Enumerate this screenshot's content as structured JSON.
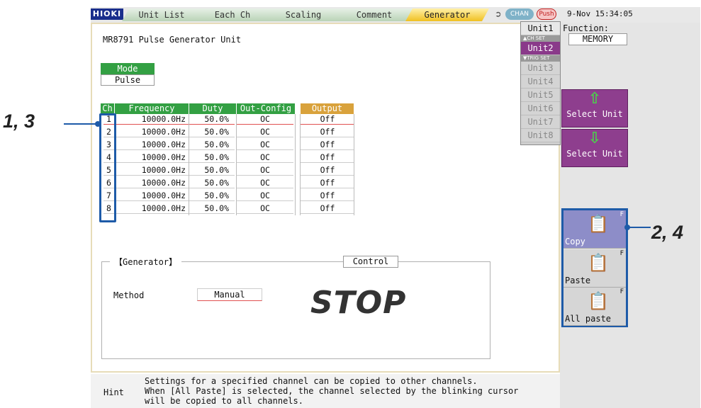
{
  "header": {
    "logo": "HIOKI",
    "tabs": [
      {
        "label": "Unit List",
        "active": false
      },
      {
        "label": "Each Ch",
        "active": false
      },
      {
        "label": "Scaling",
        "active": false
      },
      {
        "label": "Comment",
        "active": false
      },
      {
        "label": "Generator",
        "active": true
      }
    ],
    "chan_label": "CHAN",
    "push_label": "Push",
    "datetime": "9-Nov 15:34:05"
  },
  "main": {
    "unit_title": "MR8791 Pulse Generator Unit",
    "mode": {
      "header": "Mode",
      "value": "Pulse"
    },
    "table": {
      "headers": {
        "ch": "Ch",
        "frequency": "Frequency",
        "duty": "Duty",
        "out_config": "Out-Config",
        "output": "Output"
      },
      "rows": [
        {
          "ch": "1",
          "frequency": "10000.0Hz",
          "duty": "50.0%",
          "out_config": "OC",
          "output": "Off"
        },
        {
          "ch": "2",
          "frequency": "10000.0Hz",
          "duty": "50.0%",
          "out_config": "OC",
          "output": "Off"
        },
        {
          "ch": "3",
          "frequency": "10000.0Hz",
          "duty": "50.0%",
          "out_config": "OC",
          "output": "Off"
        },
        {
          "ch": "4",
          "frequency": "10000.0Hz",
          "duty": "50.0%",
          "out_config": "OC",
          "output": "Off"
        },
        {
          "ch": "5",
          "frequency": "10000.0Hz",
          "duty": "50.0%",
          "out_config": "OC",
          "output": "Off"
        },
        {
          "ch": "6",
          "frequency": "10000.0Hz",
          "duty": "50.0%",
          "out_config": "OC",
          "output": "Off"
        },
        {
          "ch": "7",
          "frequency": "10000.0Hz",
          "duty": "50.0%",
          "out_config": "OC",
          "output": "Off"
        },
        {
          "ch": "8",
          "frequency": "10000.0Hz",
          "duty": "50.0%",
          "out_config": "OC",
          "output": "Off"
        }
      ]
    },
    "generator": {
      "group_label": "【Generator】",
      "control_button": "Control",
      "method_label": "Method",
      "method_value": "Manual",
      "status": "STOP"
    }
  },
  "hint": {
    "label": "Hint",
    "line1": "Settings for a specified channel can be copied to other channels.",
    "line2": "When [All Paste] is selected, the channel selected by the blinking cursor",
    "line3": "will be copied to all channels."
  },
  "right_panel": {
    "units": [
      "Unit1",
      "Unit2",
      "Unit3",
      "Unit4",
      "Unit5",
      "Unit6",
      "Unit7",
      "Unit8"
    ],
    "active_unit": "Unit2",
    "tag_ch_set": "▲CH SET",
    "tag_trig_set": "▼TRIG SET",
    "function_label": "Function:",
    "function_value": "MEMORY",
    "select_up_label": "Select Unit",
    "select_down_label": "Select Unit",
    "copy_label": "Copy",
    "paste_label": "Paste",
    "all_paste_label": "All paste",
    "f_mark": "F"
  },
  "callouts": {
    "left": "1, 3",
    "right": "2, 4"
  },
  "colors": {
    "header_green": "#33a043",
    "output_orange": "#d9a23c",
    "unit_purple": "#8e3e8e",
    "callout_blue": "#1e5ba8",
    "copy_blue": "#8d8dc8"
  },
  "icons": {
    "undo": "undo-arrow-icon",
    "up": "arrow-up-icon",
    "down": "arrow-down-icon",
    "copy": "copy-icon",
    "paste": "paste-icon",
    "all_paste": "all-paste-icon"
  }
}
